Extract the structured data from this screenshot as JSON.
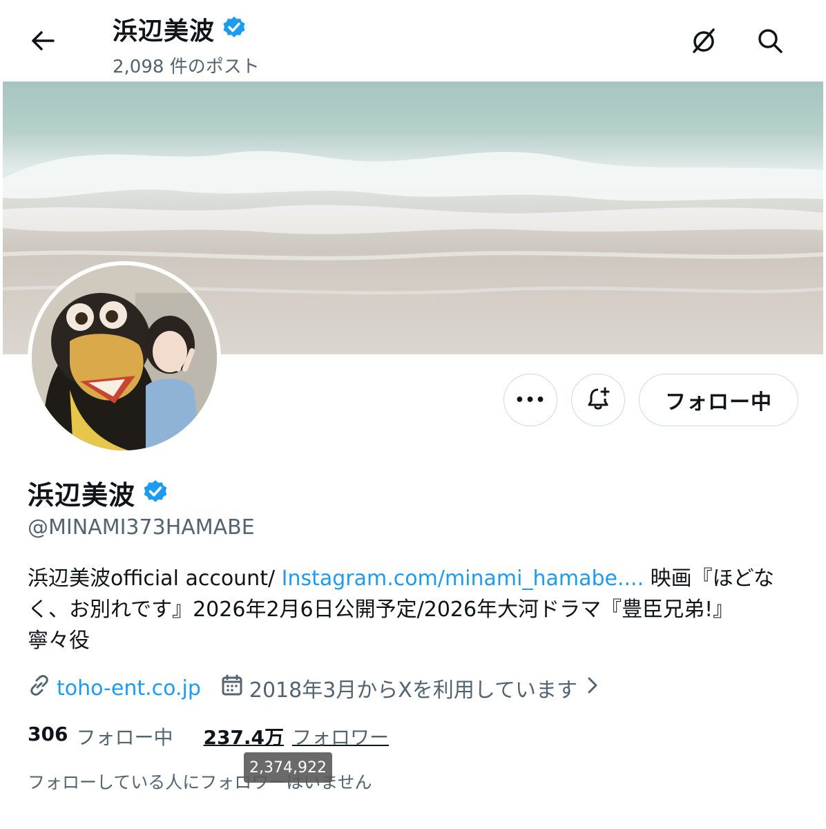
{
  "header": {
    "title": "浜辺美波",
    "post_count": "2,098 件のポスト"
  },
  "icons": {
    "back": "arrow-left-icon",
    "grok": "grok-icon",
    "search": "search-icon",
    "verified": "verified-badge-icon",
    "more": "more-dots-icon",
    "notify": "bell-plus-icon",
    "link": "link-icon",
    "calendar": "calendar-icon",
    "chevron": "chevron-right-icon"
  },
  "colors": {
    "accent": "#1d9bf0",
    "text": "#0f1419",
    "muted": "#536471",
    "border": "#cfd9de"
  },
  "actions": {
    "more_label": "•••",
    "follow_label": "フォロー中"
  },
  "profile": {
    "name": "浜辺美波",
    "handle": "@MINAMI373HAMABE",
    "bio_prefix": "浜辺美波official account/ ",
    "bio_link": "Instagram.com/minami_hamabe....",
    "bio_line1_suffix": " 映画『ほどな",
    "bio_line2": "く、お別れです』2026年2月6日公開予定/2026年大河ドラマ『豊臣兄弟!』",
    "bio_line3": "寧々役",
    "website": "toho-ent.co.jp",
    "joined": "2018年3月からXを利用しています"
  },
  "stats": {
    "following_count": "306",
    "following_label": "フォロー中",
    "followers_count": "237.4万",
    "followers_label": "フォロワー",
    "followers_tooltip": "2,374,922",
    "no_mutuals_note": "フォローしている人にフォロワーはいません"
  }
}
